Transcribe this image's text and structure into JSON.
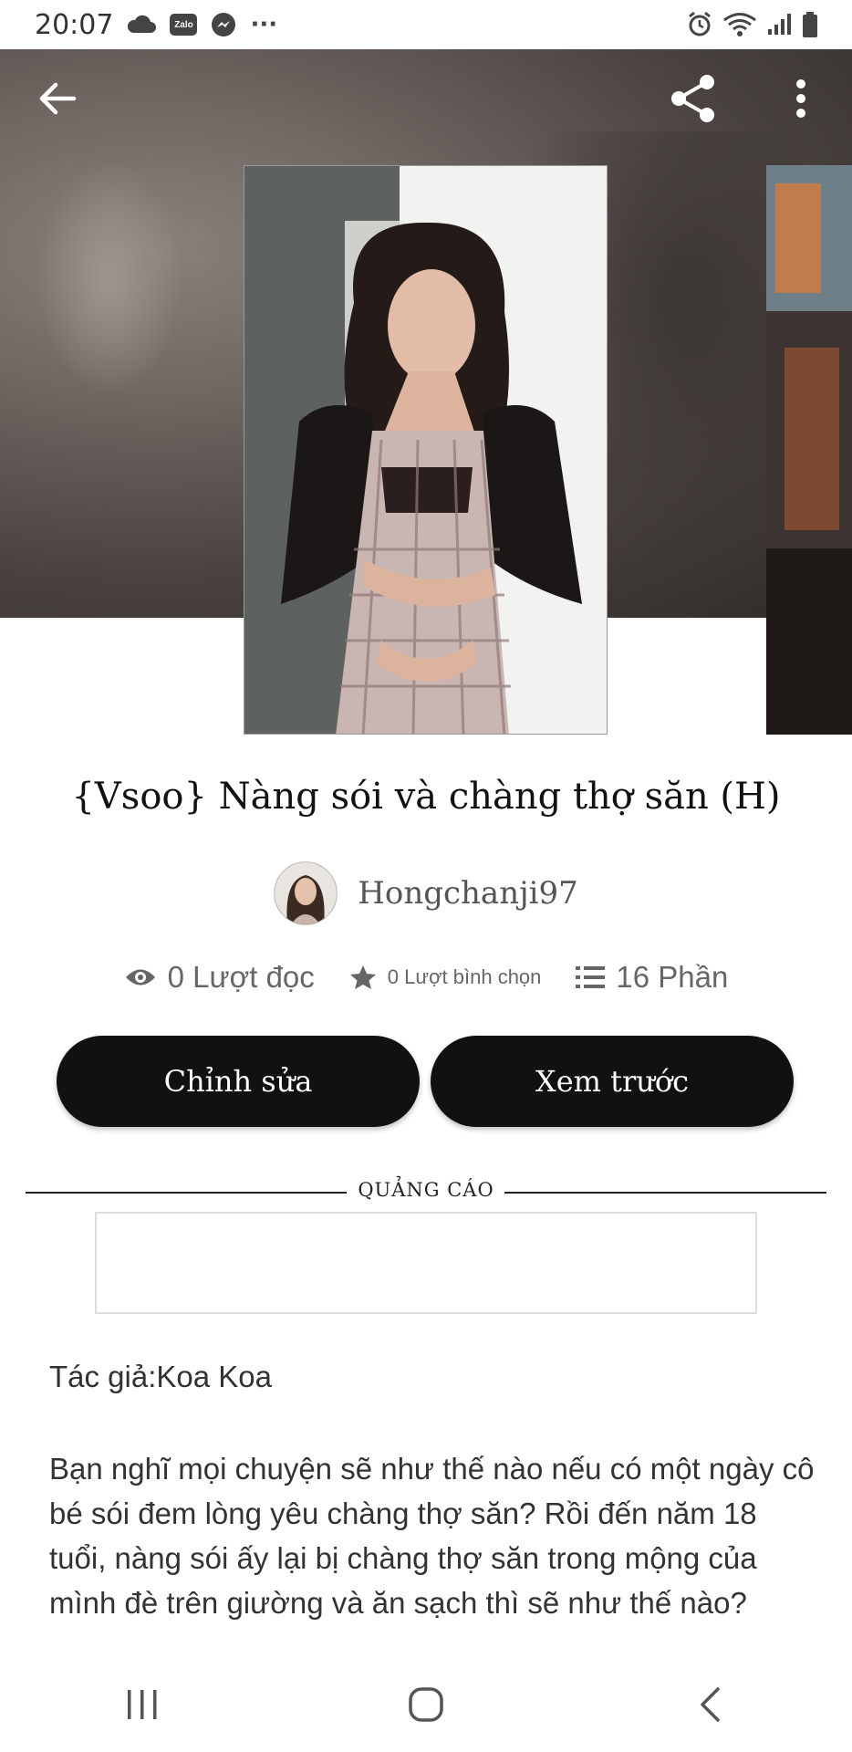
{
  "status_bar": {
    "time": "20:07",
    "zalo_label": "Zalo",
    "more": "···"
  },
  "story": {
    "title": "{Vsoo} Nàng sói và chàng thợ săn (H)",
    "author_handle": "Hongchanji97",
    "stats": {
      "reads": "0 Lượt đọc",
      "votes": "0 Lượt bình chọn",
      "parts": "16 Phần"
    }
  },
  "actions": {
    "edit_label": "Chỉnh sửa",
    "preview_label": "Xem trước"
  },
  "ad": {
    "label": "QUẢNG CÁO"
  },
  "description": {
    "author_line": "Tác giả:Koa Koa",
    "text": "Bạn nghĩ mọi chuyện sẽ như thế nào nếu có một ngày cô bé sói đem lòng yêu chàng thợ săn? Rồi đến năm 18 tuổi, nàng sói ấy lại bị chàng thợ săn trong mộng của mình đè trên giường và ăn sạch thì sẽ như thế nào?"
  },
  "icons": {
    "back": "arrow-left-icon",
    "share": "share-icon",
    "more": "more-vertical-icon",
    "reads": "eye-icon",
    "votes": "star-icon",
    "parts": "list-icon"
  }
}
